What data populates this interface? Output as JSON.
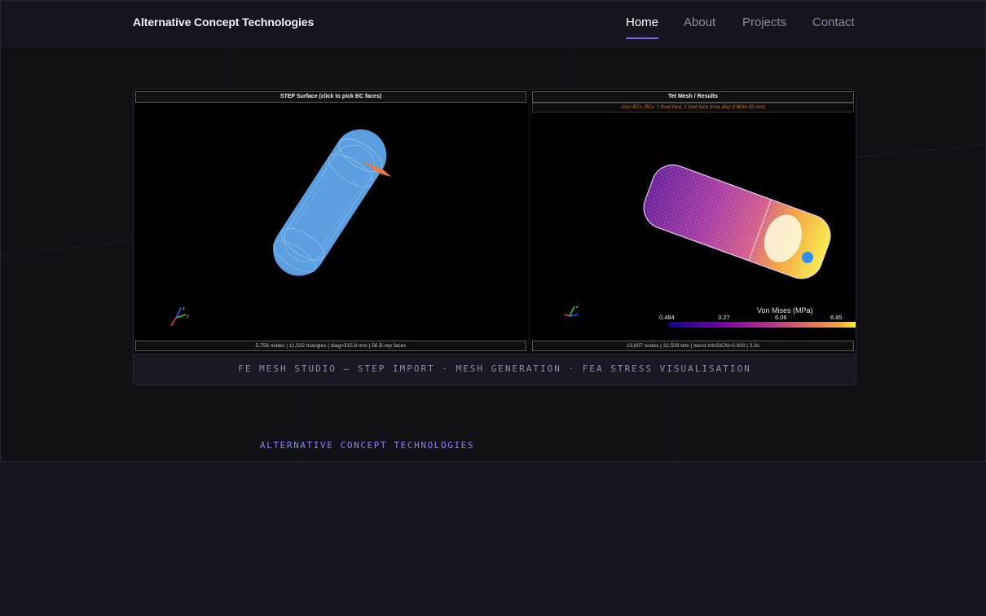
{
  "header": {
    "brand": "Alternative Concept Technologies",
    "nav": [
      {
        "label": "Home",
        "active": true
      },
      {
        "label": "About",
        "active": false
      },
      {
        "label": "Projects",
        "active": false
      },
      {
        "label": "Contact",
        "active": false
      }
    ]
  },
  "viewer": {
    "left_panel": {
      "title": "STEP Surface (click to pick BC faces)",
      "status": "5,756 nodes  |  11,532 triangles  |  diag=315.8 mm  |  56 B-rep faces"
    },
    "right_panel": {
      "title": "Tet Mesh / Results",
      "subtitle": "User BCs: BCs: 1 fixed face, 1 load face (max disp 3.963e-02 mm)",
      "status": "10,607 nodes  |  32,509 tets  |  worst minSICN=0.000  |  2.6s",
      "colorbar": {
        "title": "Von Mises (MPa)",
        "ticks": [
          "0.484",
          "3.27",
          "6.06",
          "8.85"
        ]
      }
    },
    "caption": "FE MESH STUDIO — STEP IMPORT · MESH GENERATION · FEA STRESS VISUALISATION"
  },
  "footer": {
    "brand": "ALTERNATIVE CONCEPT TECHNOLOGIES"
  },
  "colors": {
    "accent": "#6a6ff0",
    "footer_accent": "#8289ff",
    "page_bg": "#16161f",
    "surface_model": "#5b9fe0",
    "load_marker": "#f07a3c"
  },
  "icons": [
    "axis-triad-icon"
  ]
}
